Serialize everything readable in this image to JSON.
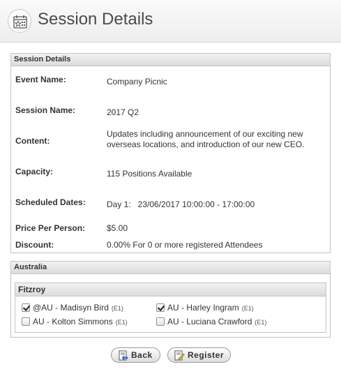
{
  "header": {
    "title": "Session Details",
    "icon": "calendar-star-icon"
  },
  "details": {
    "heading": "Session Details",
    "rows": [
      {
        "label": "Event Name:",
        "value": "Company Picnic"
      },
      {
        "label": "Session Name:",
        "value": "2017 Q2"
      },
      {
        "label": "Content:",
        "value": "Updates including announcement of our exciting new overseas locations, and introduction of our new CEO."
      },
      {
        "label": "Capacity:",
        "value": "115 Positions Available"
      },
      {
        "label": "Scheduled Dates:",
        "value": "Day 1:   23/06/2017 10:00:00 - 17:00:00"
      },
      {
        "label": "Price Per Person:",
        "value": "$5.00"
      },
      {
        "label": "Discount:",
        "value": "0.00% For 0 or more registered Attendees"
      }
    ]
  },
  "region": {
    "heading": "Australia",
    "group": {
      "heading": "Fitzroy",
      "attendees": [
        {
          "name": "@AU - Madisyn Bird",
          "tag": "(E1)",
          "checked": true
        },
        {
          "name": "AU - Harley Ingram",
          "tag": "(E1)",
          "checked": true
        },
        {
          "name": "AU - Kolton Simmons",
          "tag": "(E1)",
          "checked": false
        },
        {
          "name": "AU - Luciana Crawford",
          "tag": "(E1)",
          "checked": false
        }
      ]
    }
  },
  "buttons": {
    "back": "Back",
    "register": "Register"
  }
}
